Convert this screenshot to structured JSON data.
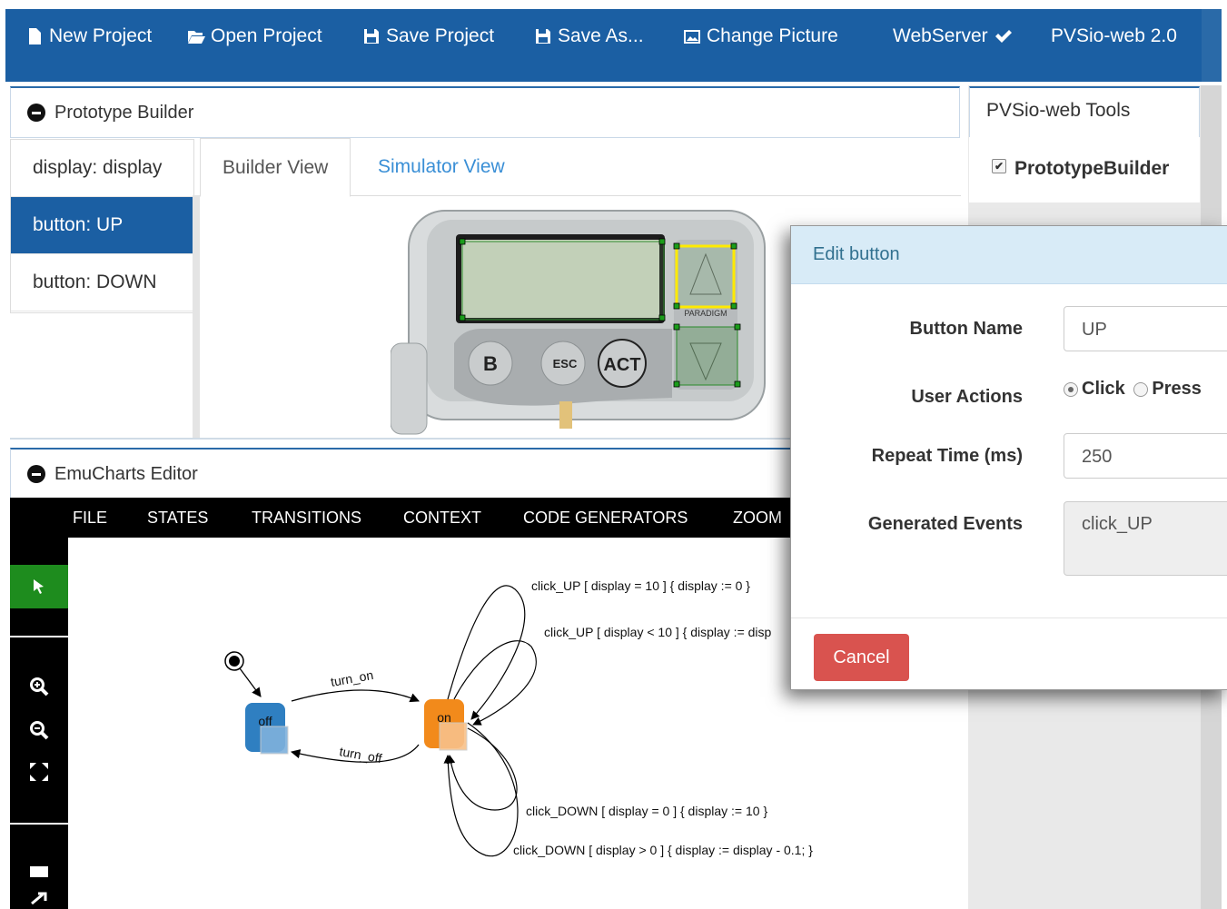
{
  "toolbar": {
    "new_project": "New Project",
    "open_project": "Open Project",
    "save_project": "Save Project",
    "save_as": "Save As...",
    "change_picture": "Change Picture",
    "webserver": "WebServer",
    "version": "PVSio-web 2.0"
  },
  "prototype_builder": {
    "title": "Prototype Builder",
    "widgets": [
      "display: display",
      "button: UP",
      "button: DOWN"
    ],
    "selected_widget": "button: UP",
    "tabs": [
      "Builder View",
      "Simulator View"
    ],
    "active_tab": "Builder View",
    "device": {
      "button_labels": [
        "B",
        "ESC",
        "ACT"
      ],
      "brand": "PARADIGM"
    }
  },
  "emucharts": {
    "title": "EmuCharts Editor",
    "menu": [
      "FILE",
      "STATES",
      "TRANSITIONS",
      "CONTEXT",
      "CODE GENERATORS",
      "ZOOM"
    ],
    "states": [
      "off",
      "on"
    ],
    "transitions": [
      "turn_on",
      "turn_off",
      "click_UP [ display = 10 ] { display := 0 }",
      "click_UP [ display < 10 ] { display := disp",
      "click_DOWN [ display = 0 ] { display := 10 }",
      "click_DOWN [ display > 0 ] { display := display - 0.1; }"
    ],
    "colors": {
      "off": "#2f7fc1",
      "on": "#f28a1b",
      "select_tool": "#1e8c1e"
    }
  },
  "sidebar": {
    "title": "PVSio-web Tools",
    "plugin": "PrototypeBuilder",
    "plugin_checked": true
  },
  "dialog": {
    "title": "Edit button",
    "button_name_label": "Button Name",
    "button_name_value": "UP",
    "user_actions_label": "User Actions",
    "action_click": "Click",
    "action_press": "Press",
    "selected_action": "Click",
    "repeat_time_label": "Repeat Time (ms)",
    "repeat_time_value": "250",
    "generated_events_label": "Generated Events",
    "generated_events_value": "click_UP",
    "cancel_label": "Cancel"
  }
}
